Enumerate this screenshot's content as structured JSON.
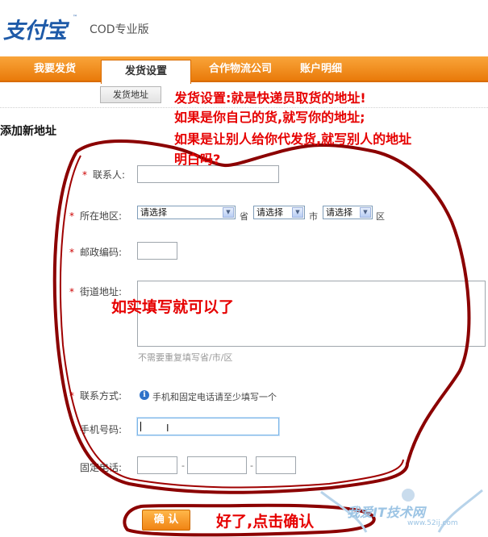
{
  "header": {
    "logo_text": "支付宝",
    "logo_tm": "™",
    "product": "COD专业版"
  },
  "nav": {
    "tabs": [
      {
        "label": "我要发货"
      },
      {
        "label": "发货设置"
      },
      {
        "label": "合作物流公司"
      },
      {
        "label": "账户明细"
      }
    ],
    "subtab": "发货地址"
  },
  "page_title": "添加新地址",
  "form": {
    "required_mark": "*",
    "contact_label": "联系人:",
    "region_label": "所在地区:",
    "select_default": "请选择",
    "province_unit": "省",
    "city_unit": "市",
    "district_unit": "区",
    "postcode_label": "邮政编码:",
    "street_label": "街道地址:",
    "street_hint": "不需要重复填写省/市/区",
    "contact_method_label": "联系方式:",
    "contact_method_hint": "手机和固定电话请至少填写一个",
    "mobile_label": "手机号码:",
    "phone_label": "固定电话:",
    "phone_sep": "-",
    "info_icon_glyph": "i",
    "ibeam_glyph": "I"
  },
  "confirm_button": "确 认",
  "annotations": {
    "line1": "发货设置:就是快递员取货的地址!",
    "line2": "如果是你自己的货,就写你的地址;",
    "line3": "如果是让别人给你代发货,就写别人的地址",
    "line4": "明白吗?",
    "mid": "如实填写就可以了",
    "bottom": "好了,点击确认"
  },
  "watermark": {
    "text": "我爱IT技术网",
    "url": "www.52ij.com"
  },
  "colors": {
    "nav_orange": "#f29322",
    "annotation_red": "#e60000",
    "brand_blue": "#1e5aa8"
  }
}
